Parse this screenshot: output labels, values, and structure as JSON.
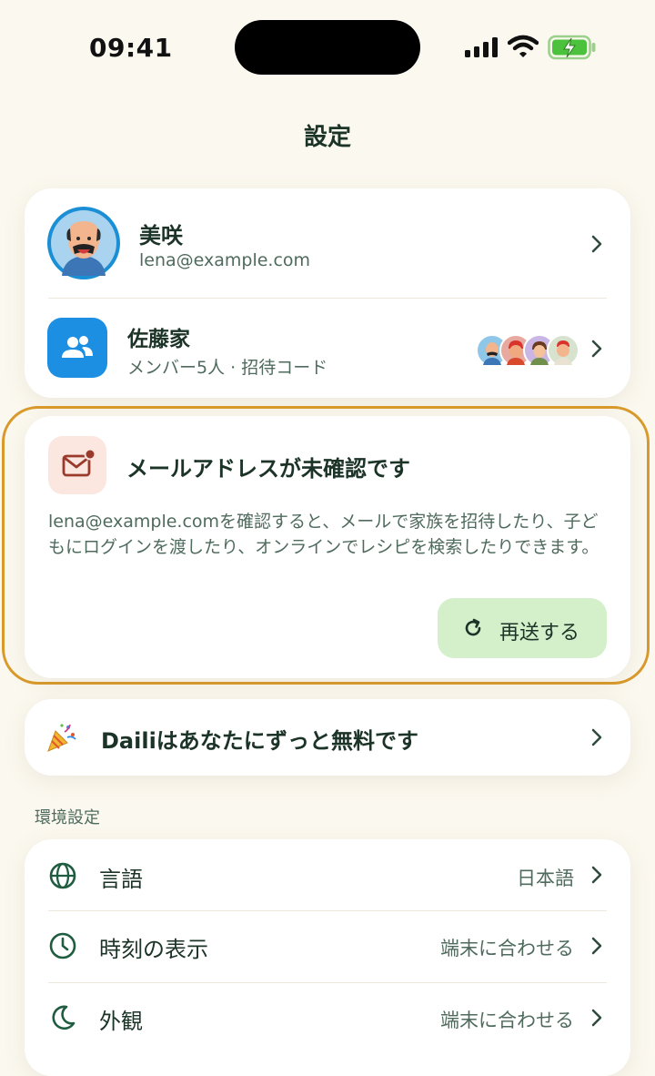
{
  "status_bar": {
    "time": "09:41"
  },
  "page": {
    "title": "設定"
  },
  "account": {
    "name": "美咲",
    "email": "lena@example.com"
  },
  "family": {
    "name": "佐藤家",
    "subtitle": "メンバー5人 · 招待コード"
  },
  "verify_banner": {
    "title": "メールアドレスが未確認です",
    "body": "lena@example.comを確認すると、メールで家族を招待したり、子どもにログインを渡したり、オンラインでレシピを検索したりできます。",
    "resend_label": "再送する"
  },
  "promo": {
    "icon": "party-popper-icon",
    "text": "Dailiはあなたにずっと無料です"
  },
  "preferences": {
    "section_title": "環境設定",
    "items": [
      {
        "label": "言語",
        "value": "日本語",
        "icon": "globe-icon"
      },
      {
        "label": "時刻の表示",
        "value": "端末に合わせる",
        "icon": "clock-icon"
      },
      {
        "label": "外観",
        "value": "端末に合わせる",
        "icon": "moon-icon"
      }
    ]
  },
  "colors": {
    "background": "#fbf8ef",
    "accent_green": "#1f5c40",
    "resend_bg": "#d3f0cb",
    "warning_outline": "#d99a2b",
    "family_icon_bg": "#1d8fe2"
  }
}
